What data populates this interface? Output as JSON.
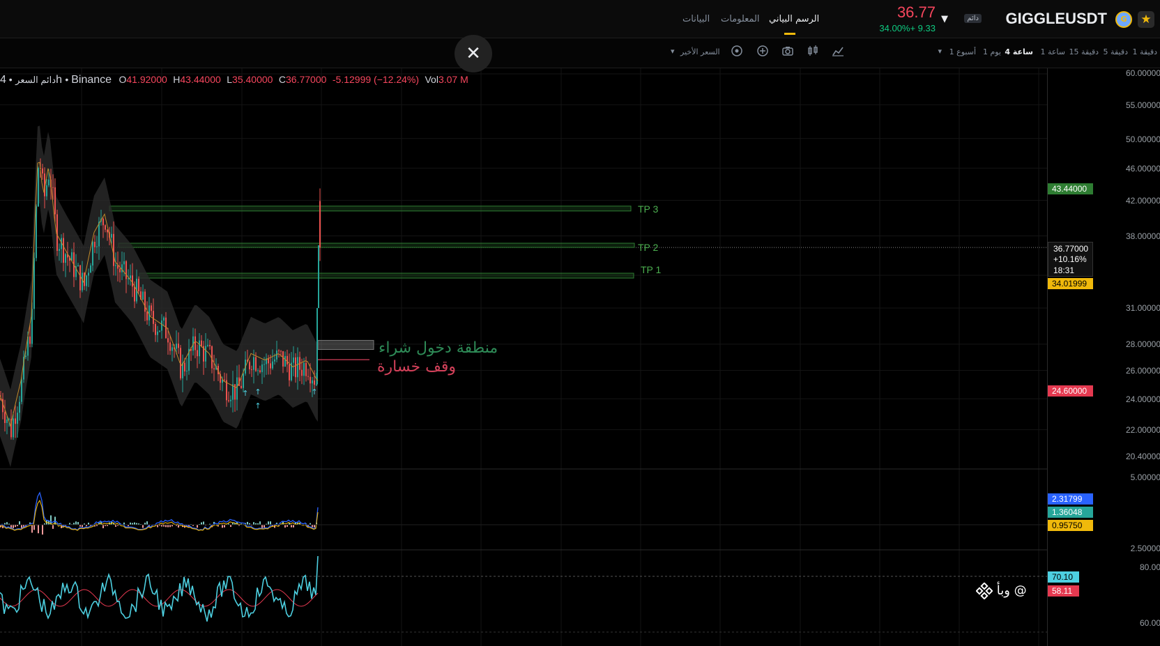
{
  "header": {
    "symbol": "GIGGLEUSDT",
    "perp_badge": "دائم",
    "coin_icon": "giggle-coin-icon",
    "favorite_icon": "star-icon",
    "last_price": "36.77",
    "change": "34.00%+ 9.33",
    "tabs": [
      {
        "label": "الرسم البياني",
        "active": true
      },
      {
        "label": "المعلومات",
        "active": false
      },
      {
        "label": "البيانات",
        "active": false
      }
    ],
    "colors": {
      "up": "#0ecb81",
      "down": "#f6465d",
      "accent": "#f0b90b"
    }
  },
  "toolbar": {
    "timeframes": [
      "1 دقيقة",
      "5 دقيقة",
      "15 دقيقة",
      "1 ساعة",
      "4 ساعة",
      "1 يوم",
      "1 أسبوع"
    ],
    "active_timeframe": "4 ساعة",
    "price_source": "السعر الأخير",
    "icons": [
      "line-chart-icon",
      "candles-icon",
      "camera-icon",
      "add-indicator-icon",
      "settings-icon"
    ]
  },
  "legend": {
    "prefix": "دائم السعر",
    "interval": "4h",
    "exchange": "Binance",
    "open_label": "O",
    "open": "41.92000",
    "high_label": "H",
    "high": "43.44000",
    "low_label": "L",
    "low": "35.40000",
    "close_label": "C",
    "close": "36.77000",
    "change": "-5.12999 (−12.24%)",
    "vol_label": "Vol",
    "vol": "3.07 M"
  },
  "close_button_icon": "close-icon",
  "annotations": {
    "tp3": "TP 3",
    "tp2": "TP 2",
    "tp1": "TP 1",
    "entry_zone": "منطقة دخول شراء",
    "stop_loss": "وقف خسارة"
  },
  "price_axis": {
    "ticks": [
      "60.00000",
      "55.00000",
      "50.00000",
      "46.00000",
      "42.00000",
      "38.00000",
      "31.00000",
      "28.00000",
      "26.00000",
      "24.00000",
      "22.00000",
      "20.40000"
    ],
    "labels": {
      "high": "43.44000",
      "current": "36.77000",
      "current_change": "+10.16%",
      "countdown": "18:31",
      "level": "34.01999",
      "low": "24.60000"
    }
  },
  "macd_axis": {
    "ticks": [
      "5.00000",
      "2.50000"
    ],
    "labels": [
      "2.31799",
      "1.36048",
      "0.95750"
    ]
  },
  "rsi_axis": {
    "ticks": [
      "80.00",
      "60.00"
    ],
    "labels": [
      "70.10",
      "58.11"
    ]
  },
  "watermark": "وبأ @",
  "watermark_icon": "binance-logo-icon",
  "chart_data": {
    "type": "candlestick",
    "symbol": "GIGGLEUSDT",
    "interval": "4h",
    "ylim": [
      19.5,
      60.5
    ],
    "log_scale": true,
    "last": {
      "open": 41.92,
      "high": 43.44,
      "low": 35.4,
      "close": 36.77
    },
    "levels": {
      "tp3": 41.0,
      "tp2": 37.0,
      "tp1": 34.0,
      "entry_top": 28.3,
      "entry_bottom": 27.8,
      "stop_loss": 26.8
    },
    "indicators": [
      "MACD",
      "RSI"
    ]
  }
}
